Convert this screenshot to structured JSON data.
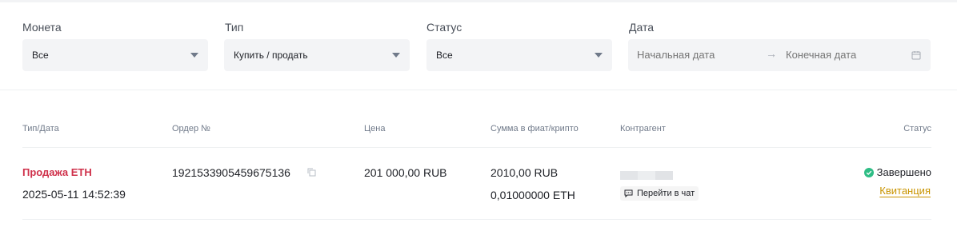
{
  "filters": {
    "coin": {
      "label": "Монета",
      "value": "Все"
    },
    "type": {
      "label": "Тип",
      "value": "Купить / продать"
    },
    "status": {
      "label": "Статус",
      "value": "Все"
    },
    "date": {
      "label": "Дата",
      "start_placeholder": "Начальная дата",
      "end_placeholder": "Конечная дата"
    }
  },
  "table": {
    "headers": {
      "type_date": "Тип/Дата",
      "order": "Ордер №",
      "price": "Цена",
      "amount": "Сумма в фиат/крипто",
      "counterparty": "Контрагент",
      "status": "Статус"
    },
    "rows": [
      {
        "type": "Продажа ETH",
        "datetime": "2025-05-11 14:52:39",
        "order_no": "1921533905459675136",
        "price": "201 000,00 RUB",
        "fiat_amount": "2010,00 RUB",
        "crypto_amount": "0,01000000 ETH",
        "chat_label": "Перейти в чат",
        "status": "Завершено",
        "receipt_label": "Квитанция"
      }
    ]
  },
  "colors": {
    "sell": "#cf304a",
    "success": "#2ebd85",
    "link": "#c99400"
  }
}
